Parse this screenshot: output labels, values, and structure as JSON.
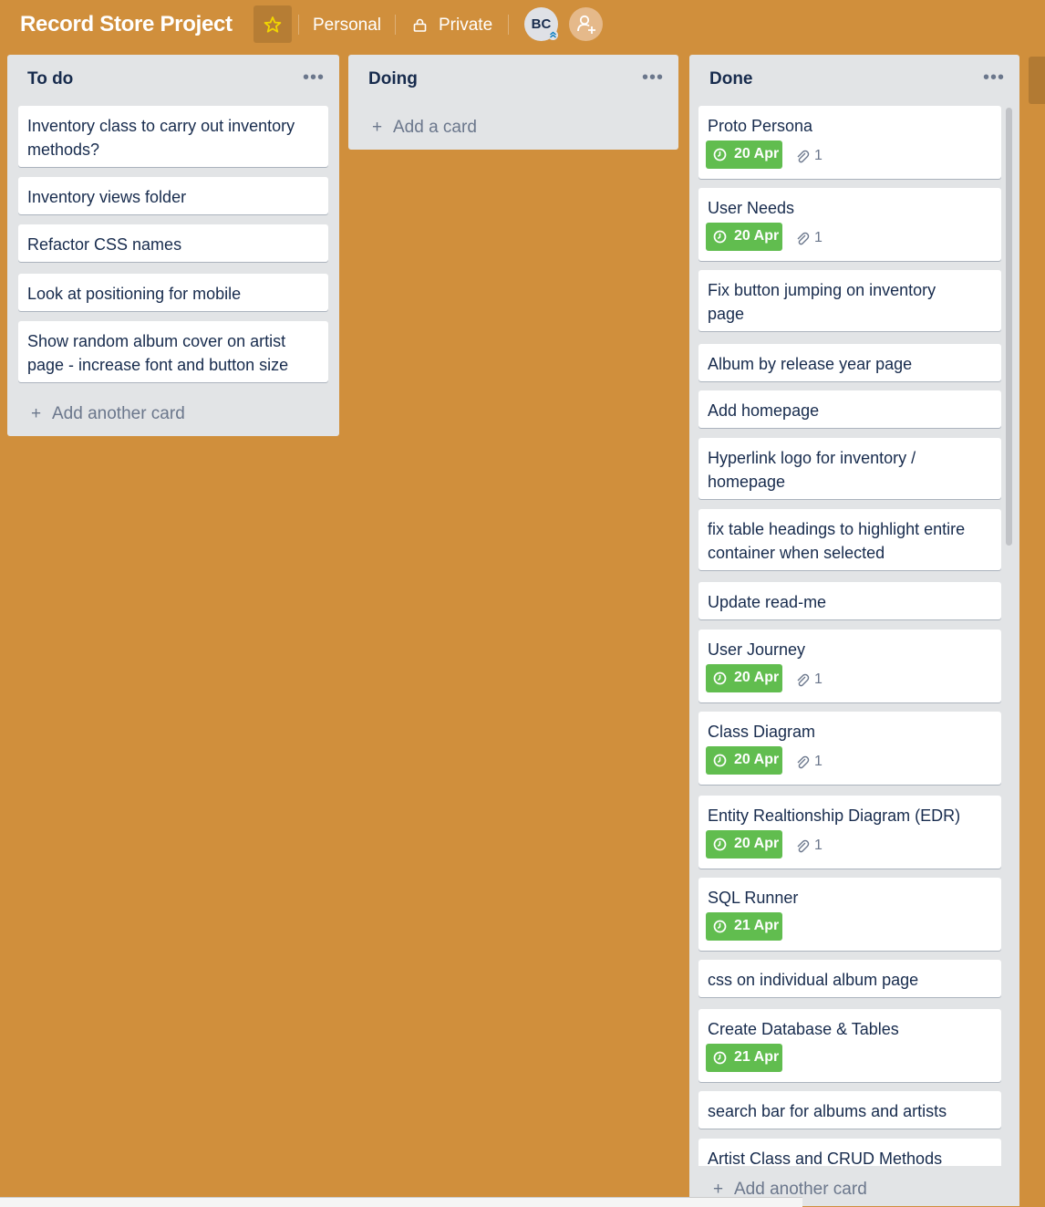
{
  "header": {
    "board_title": "Record Store Project",
    "team": "Personal",
    "visibility": "Private",
    "avatar_initials": "BC"
  },
  "lists": [
    {
      "title": "To do",
      "add_label": "Add another card",
      "cards": [
        {
          "lines": [
            "Inventory class to carry out inventory",
            "methods?"
          ]
        },
        {
          "lines": [
            "Inventory views folder"
          ]
        },
        {
          "lines": [
            "Refactor CSS names"
          ]
        },
        {
          "lines": [
            "Look at positioning for mobile"
          ]
        },
        {
          "lines": [
            "Show random album cover on artist",
            "page - increase font and button size"
          ]
        }
      ]
    },
    {
      "title": "Doing",
      "add_label": "Add a card",
      "cards": []
    },
    {
      "title": "Done",
      "add_label": "Add another card",
      "cards": [
        {
          "lines": [
            "Proto Persona"
          ],
          "due": "20 Apr",
          "attachments": "1"
        },
        {
          "lines": [
            "User Needs"
          ],
          "due": "20 Apr",
          "attachments": "1"
        },
        {
          "lines": [
            "Fix button jumping on inventory",
            "page"
          ]
        },
        {
          "lines": [
            "Album by release year page"
          ]
        },
        {
          "lines": [
            "Add homepage"
          ]
        },
        {
          "lines": [
            "Hyperlink logo for inventory /",
            "homepage"
          ]
        },
        {
          "lines": [
            "fix table headings to highlight entire",
            "container when selected"
          ]
        },
        {
          "lines": [
            "Update read-me"
          ]
        },
        {
          "lines": [
            "User Journey"
          ],
          "due": "20 Apr",
          "attachments": "1"
        },
        {
          "lines": [
            "Class Diagram"
          ],
          "due": "20 Apr",
          "attachments": "1"
        },
        {
          "lines": [
            "Entity Realtionship Diagram (EDR)"
          ],
          "due": "20 Apr",
          "attachments": "1"
        },
        {
          "lines": [
            "SQL Runner"
          ],
          "due": "21 Apr"
        },
        {
          "lines": [
            "css on individual album page"
          ]
        },
        {
          "lines": [
            "Create Database & Tables"
          ],
          "due": "21 Apr"
        },
        {
          "lines": [
            "search bar for albums and artists"
          ]
        },
        {
          "lines": [
            "Artist Class and CRUD Methods"
          ]
        }
      ]
    }
  ],
  "colors": {
    "board_background": "#d08f3c",
    "list_background": "#e2e4e6",
    "due_badge": "#61bd4f",
    "text": "#172b4d"
  }
}
